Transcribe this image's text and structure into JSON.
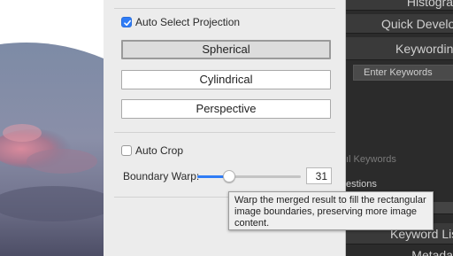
{
  "dialog": {
    "auto_select_projection": {
      "label": "Auto Select Projection",
      "checked": true
    },
    "projections": [
      {
        "label": "Spherical",
        "selected": true
      },
      {
        "label": "Cylindrical",
        "selected": false
      },
      {
        "label": "Perspective",
        "selected": false
      }
    ],
    "auto_crop": {
      "label": "Auto Crop",
      "checked": false
    },
    "boundary_warp": {
      "label": "Boundary Warp:",
      "value": "31",
      "level": 0.31
    },
    "tooltip": {
      "lines": [
        "Warp the merged result to fill the rectangular",
        "image boundaries, preserving more image",
        "content."
      ]
    }
  },
  "lightroom_panel": {
    "histogram": "Histogra",
    "quick_develop": "Quick Develo",
    "keywording": "Keywordin",
    "enter_keywords": "Enter Keywords",
    "keywords_partial": "ıl Keywords",
    "suggestions_partial": "estions",
    "keyword_list": "Keyword Lis",
    "metadata": "Metada"
  },
  "colors": {
    "accent": "#2f7cf6",
    "dialog_bg": "#ececec",
    "panel_bg": "#2b2b2b"
  }
}
